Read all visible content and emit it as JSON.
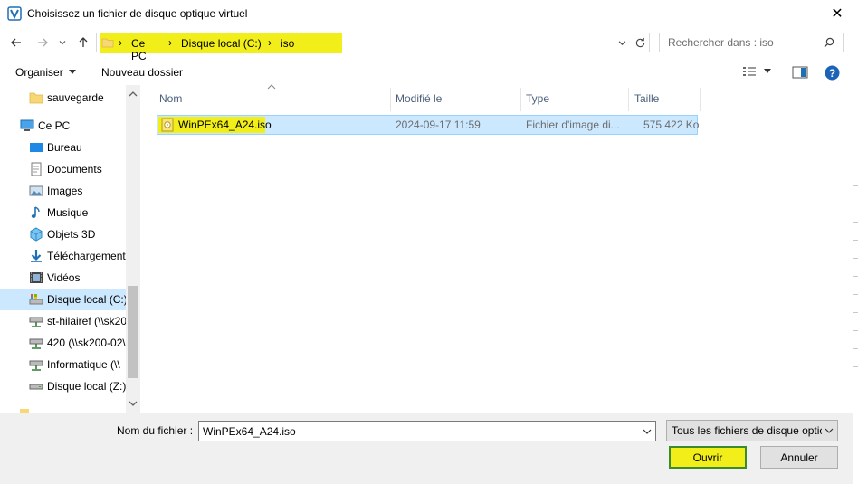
{
  "window": {
    "title": "Choisissez un fichier de disque optique virtuel",
    "close_glyph": "✕"
  },
  "address": {
    "crumbs": [
      "Ce PC",
      "Disque local (C:)",
      "iso"
    ],
    "search_placeholder": "Rechercher dans : iso",
    "highlight_color": "#f1ee1a"
  },
  "toolbar": {
    "organize_label": "Organiser",
    "new_folder_label": "Nouveau dossier"
  },
  "nav": {
    "items": [
      {
        "label": "sauvegarde",
        "icon": "folder-icon"
      },
      {
        "label": "Ce PC",
        "icon": "computer-icon"
      },
      {
        "label": "Bureau",
        "icon": "desktop-icon"
      },
      {
        "label": "Documents",
        "icon": "documents-icon"
      },
      {
        "label": "Images",
        "icon": "pictures-icon"
      },
      {
        "label": "Musique",
        "icon": "music-icon"
      },
      {
        "label": "Objets 3D",
        "icon": "3d-objects-icon"
      },
      {
        "label": "Téléchargements",
        "icon": "downloads-icon"
      },
      {
        "label": "Vidéos",
        "icon": "videos-icon"
      },
      {
        "label": "Disque local (C:)",
        "icon": "drive-icon"
      },
      {
        "label": "st-hilairef (\\\\sk20",
        "icon": "network-drive-icon"
      },
      {
        "label": "420 (\\\\sk200-02\\",
        "icon": "network-drive-icon"
      },
      {
        "label": "Informatique (\\\\",
        "icon": "network-drive-icon"
      },
      {
        "label": "Disque local (Z:)",
        "icon": "drive-icon"
      }
    ]
  },
  "files": {
    "columns": [
      "Nom",
      "Modifié le",
      "Type",
      "Taille"
    ],
    "rows": [
      {
        "name": "WinPEx64_A24.iso",
        "modified": "2024-09-17 11:59",
        "type": "Fichier d'image di...",
        "size": "575 422 Ko"
      }
    ]
  },
  "footer": {
    "filename_label": "Nom du fichier :",
    "filename_value": "WinPEx64_A24.iso",
    "filter_value": "Tous les fichiers de disque optic",
    "open_label": "Ouvrir",
    "cancel_label": "Annuler"
  }
}
